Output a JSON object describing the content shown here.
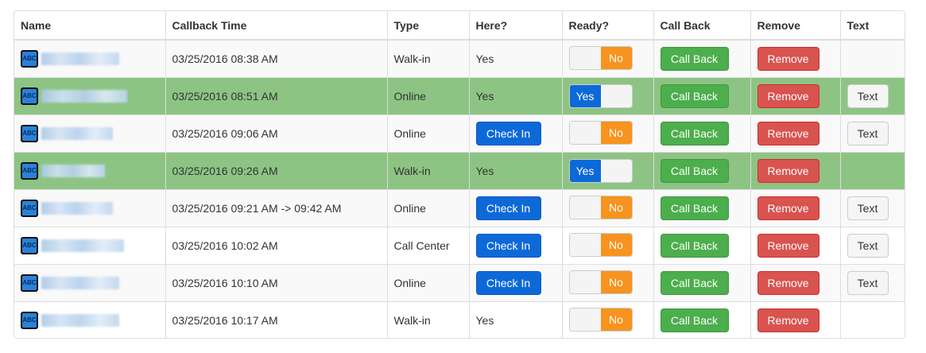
{
  "columns": [
    "Name",
    "Callback Time",
    "Type",
    "Here?",
    "Ready?",
    "Call Back",
    "Remove",
    "Text"
  ],
  "icon_label": "ABC",
  "rows": [
    {
      "callback_time": "03/25/2016 08:38 AM",
      "type": "Walk-in",
      "here": "Yes",
      "ready": "No",
      "call_back": "Call Back",
      "remove": "Remove",
      "text": ""
    },
    {
      "callback_time": "03/25/2016 08:51 AM",
      "type": "Online",
      "here": "Yes",
      "ready": "Yes",
      "call_back": "Call Back",
      "remove": "Remove",
      "text": "Text"
    },
    {
      "callback_time": "03/25/2016 09:06 AM",
      "type": "Online",
      "here": "Check In",
      "ready": "No",
      "call_back": "Call Back",
      "remove": "Remove",
      "text": "Text"
    },
    {
      "callback_time": "03/25/2016 09:26 AM",
      "type": "Walk-in",
      "here": "Yes",
      "ready": "Yes",
      "call_back": "Call Back",
      "remove": "Remove",
      "text": ""
    },
    {
      "callback_time": "03/25/2016 09:21 AM -> 09:42 AM",
      "type": "Online",
      "here": "Check In",
      "ready": "No",
      "call_back": "Call Back",
      "remove": "Remove",
      "text": "Text"
    },
    {
      "callback_time": "03/25/2016 10:02 AM",
      "type": "Call Center",
      "here": "Check In",
      "ready": "No",
      "call_back": "Call Back",
      "remove": "Remove",
      "text": "Text"
    },
    {
      "callback_time": "03/25/2016 10:10 AM",
      "type": "Online",
      "here": "Check In",
      "ready": "No",
      "call_back": "Call Back",
      "remove": "Remove",
      "text": "Text"
    },
    {
      "callback_time": "03/25/2016 10:17 AM",
      "type": "Walk-in",
      "here": "Yes",
      "ready": "No",
      "call_back": "Call Back",
      "remove": "Remove",
      "text": ""
    }
  ],
  "colors": {
    "ready_row": "#8dc484",
    "check_in": "#0d69d8",
    "call_back": "#4cae4c",
    "remove": "#d9534f",
    "toggle_no": "#f7931e",
    "toggle_yes": "#0d69d8"
  }
}
